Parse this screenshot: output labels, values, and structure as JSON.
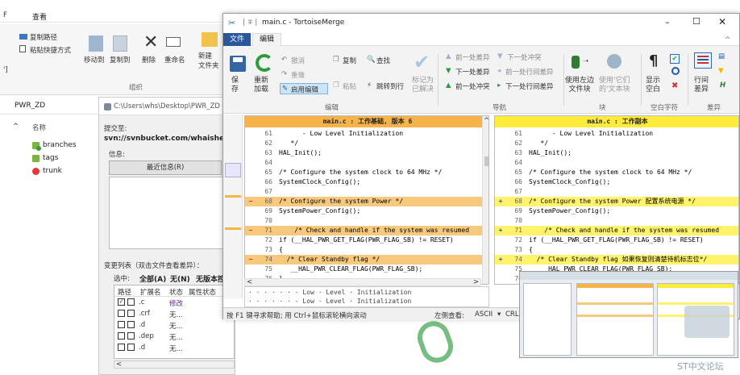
{
  "explorer": {
    "ribbon_tab_view": "查看",
    "copy_path": "复制路径",
    "paste_shortcut": "粘贴快捷方式",
    "move_to": "移动到",
    "copy_to": "复制到",
    "delete": "删除",
    "rename": "重命名",
    "new_folder": "新建\n文件夹",
    "group_organize": "组织",
    "address": "PWR_ZD",
    "col_name": "名称",
    "items": [
      "branches",
      "tags",
      "trunk"
    ]
  },
  "commit": {
    "title": "C:\\Users\\whs\\Desktop\\PWR_ZD",
    "commit_to_label": "提交至:",
    "url": "svn://svnbucket.com/whaishen",
    "message_label": "信息:",
    "recent_messages_button": "最近信息(R)",
    "changes_label": "变更列表（双击文件查看差异）：",
    "select_label": "选中:",
    "select_all": "全部(A)",
    "select_none": "无(N)",
    "select_unversioned": "无版本控",
    "columns": [
      "路径",
      "扩展名",
      "状态",
      "属性状态"
    ],
    "rows": [
      {
        "path": ".c",
        "status": "修改"
      },
      {
        "path": ".crf",
        "status": "无..."
      },
      {
        "path": ".d",
        "status": "无..."
      },
      {
        "path": ".dep",
        "status": "无..."
      },
      {
        "path": ".d",
        "status": "无..."
      }
    ]
  },
  "merge": {
    "title": "main.c - TortoiseMerge",
    "tab_file": "文件",
    "tab_edit": "编辑",
    "save": "保\n存",
    "reload": "重新\n加载",
    "undo": "撤消",
    "redo": "重做",
    "enable_edit": "启用编辑",
    "copy": "复制",
    "paste": "粘贴",
    "find": "查找",
    "goto_line": "跳转到行",
    "mark_resolved": "标记为\n已解决",
    "prev_diff": "前一处差异",
    "next_diff": "下一处差异",
    "prev_conflict": "前一处冲突",
    "next_conflict": "下一处冲突",
    "prev_inline": "前一处行间差异",
    "next_inline": "下一处行间差异",
    "use_left_block": "使用左边\n文件块",
    "use_other_block": "使用'它们\n的'文本块",
    "show_whitespace": "显示\n空白",
    "inline_diff": "行间\n差异",
    "group_edit": "编辑",
    "group_nav": "导航",
    "group_block": "块",
    "group_whitespace": "空白字符",
    "group_diff": "差异",
    "left_header": "main.c : 工作基础, 版本 6",
    "right_header": "main.c : 工作副本",
    "left_lines": [
      {
        "n": "61",
        "m": "",
        "t": "      - Low Level Initialization",
        "hl": ""
      },
      {
        "n": "62",
        "m": "",
        "t": "   */",
        "hl": ""
      },
      {
        "n": "63",
        "m": "",
        "t": "HAL_Init();",
        "hl": ""
      },
      {
        "n": "64",
        "m": "",
        "t": "",
        "hl": ""
      },
      {
        "n": "65",
        "m": "",
        "t": "/* Configure the system clock to 64 MHz */",
        "hl": ""
      },
      {
        "n": "66",
        "m": "",
        "t": "SystemClock_Config();",
        "hl": ""
      },
      {
        "n": "67",
        "m": "",
        "t": "",
        "hl": ""
      },
      {
        "n": "68",
        "m": "−",
        "t": "/* Configure the system Power */",
        "hl": "#f7c97c"
      },
      {
        "n": "69",
        "m": "",
        "t": "SystemPower_Config();",
        "hl": ""
      },
      {
        "n": "70",
        "m": "",
        "t": "",
        "hl": ""
      },
      {
        "n": "71",
        "m": "−",
        "t": "    /* Check and handle if the system was resumed",
        "hl": "#f7c97c"
      },
      {
        "n": "72",
        "m": "",
        "t": "if (__HAL_PWR_GET_FLAG(PWR_FLAG_SB) != RESET)",
        "hl": ""
      },
      {
        "n": "73",
        "m": "",
        "t": "{",
        "hl": ""
      },
      {
        "n": "74",
        "m": "−",
        "t": "  /* Clear Standby flag */",
        "hl": "#f7c97c"
      },
      {
        "n": "75",
        "m": "",
        "t": "   __HAL_PWR_CLEAR_FLAG(PWR_FLAG_SB);",
        "hl": ""
      },
      {
        "n": "76",
        "m": "",
        "t": "}",
        "hl": ""
      }
    ],
    "right_lines": [
      {
        "n": "61",
        "m": "",
        "t": "      - Low Level Initialization",
        "hl": ""
      },
      {
        "n": "62",
        "m": "",
        "t": "   */",
        "hl": ""
      },
      {
        "n": "63",
        "m": "",
        "t": "HAL_Init();",
        "hl": ""
      },
      {
        "n": "64",
        "m": "",
        "t": "",
        "hl": ""
      },
      {
        "n": "65",
        "m": "",
        "t": "/* Configure the system clock to 64 MHz */",
        "hl": ""
      },
      {
        "n": "66",
        "m": "",
        "t": "SystemClock_Config();",
        "hl": ""
      },
      {
        "n": "67",
        "m": "",
        "t": "",
        "hl": ""
      },
      {
        "n": "68",
        "m": "+",
        "t": "/* Configure the system Power 配置系统电源 */",
        "hl": "#fff36b"
      },
      {
        "n": "69",
        "m": "",
        "t": "SystemPower_Config();",
        "hl": ""
      },
      {
        "n": "70",
        "m": "",
        "t": "",
        "hl": ""
      },
      {
        "n": "71",
        "m": "+",
        "t": "    /* Check and handle if the system was resumed",
        "hl": "#fff36b"
      },
      {
        "n": "72",
        "m": "",
        "t": "if (__HAL_PWR_GET_FLAG(PWR_FLAG_SB) != RESET)",
        "hl": ""
      },
      {
        "n": "73",
        "m": "",
        "t": "{",
        "hl": ""
      },
      {
        "n": "74",
        "m": "+",
        "t": "  /* Clear Standby flag 如果恢复则清楚待机标志位*/",
        "hl": "#fff36b"
      },
      {
        "n": "75",
        "m": "",
        "t": "   __HAL_PWR_CLEAR_FLAG(PWR_FLAG_SB);",
        "hl": ""
      },
      {
        "n": "76",
        "m": "",
        "t": "}",
        "hl": ""
      }
    ],
    "bottom_line1": "· · · · · · - Low · Level · Initialization",
    "bottom_line2": "· · · · · · - Low · Level · Initialization",
    "status_help": "按 F1 键寻求帮助; 用 Ctrl+鼠标滚轮横向滚动",
    "status_left_view": "左侧查看:",
    "status_encoding": "ASCII",
    "status_eol": "CRL"
  },
  "watermark": "ST中文论坛",
  "colors": {
    "accent": "#2b579a",
    "left_header": "#f5b34a",
    "right_header": "#ffeb3b",
    "removed": "#f7c97c",
    "added": "#fff36b"
  }
}
